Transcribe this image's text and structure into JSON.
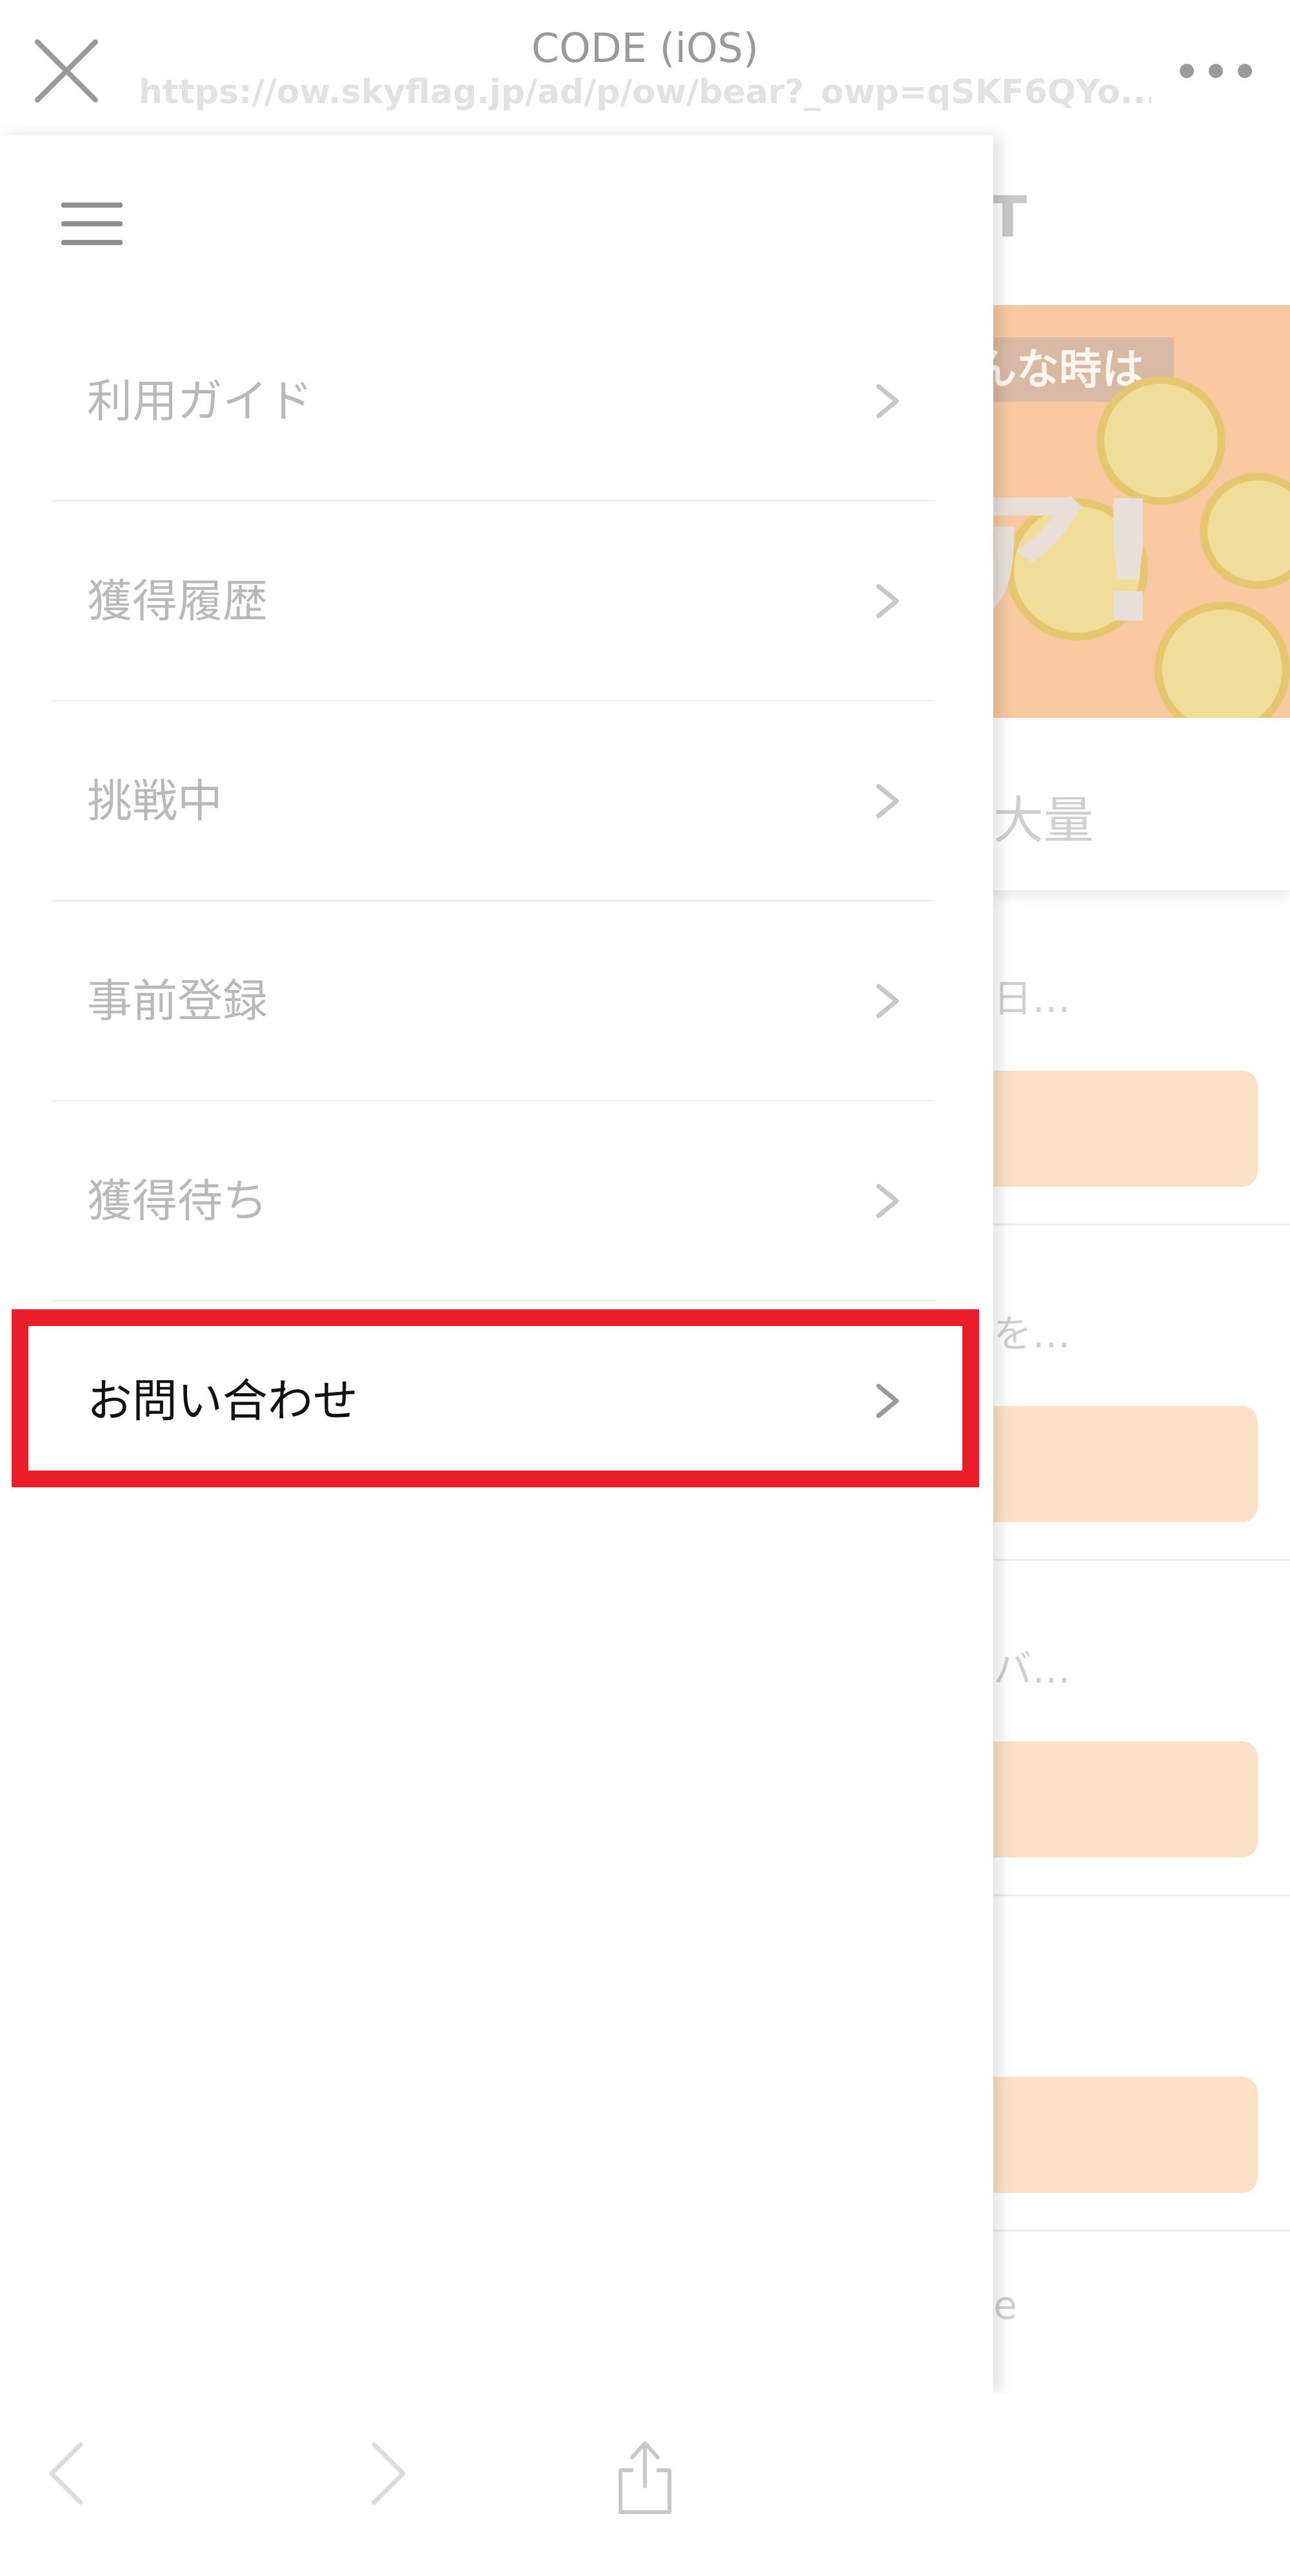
{
  "browser": {
    "title": "CODE (iOS)",
    "url": "https://ow.skyflag.jp/ad/p/ow/bear?_owp=qSKF6QYo...",
    "close_icon": "close-icon",
    "more_icon": "more-horizontal-icon"
  },
  "background_page": {
    "header_fragment": "GET",
    "banner_tag": "んな時は",
    "banner_exclaim": "ア!",
    "subtitle_fragment": "大量",
    "rows": [
      {
        "text": "日…"
      },
      {
        "text": "を…"
      },
      {
        "text": "バ…"
      },
      {
        "text": ""
      },
      {
        "text": "e"
      }
    ]
  },
  "drawer": {
    "menu_icon": "hamburger-icon",
    "items": [
      {
        "label": "利用ガイド"
      },
      {
        "label": "獲得履歴"
      },
      {
        "label": "挑戦中"
      },
      {
        "label": "事前登録"
      },
      {
        "label": "獲得待ち"
      },
      {
        "label": "お問い合わせ",
        "highlighted": true
      }
    ]
  },
  "toolbar": {
    "back_icon": "back-arrow-icon",
    "forward_icon": "forward-arrow-icon",
    "share_icon": "share-icon"
  },
  "colors": {
    "highlight": "#e91e2a",
    "muted_text": "#b9b9b9",
    "active_text": "#111111",
    "button_fill": "#fde1c7"
  }
}
